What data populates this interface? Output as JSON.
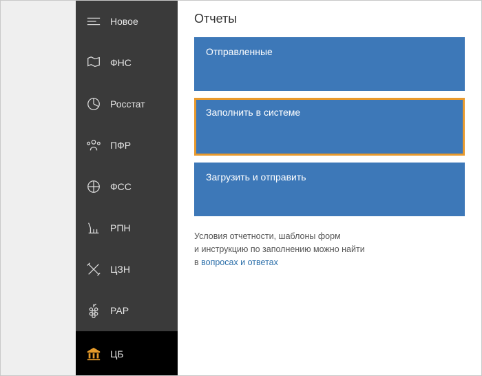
{
  "sidebar": {
    "items": [
      {
        "label": "Новое",
        "icon": "new-icon"
      },
      {
        "label": "ФНС",
        "icon": "flag-icon"
      },
      {
        "label": "Росстат",
        "icon": "piechart-icon"
      },
      {
        "label": "ПФР",
        "icon": "people-icon"
      },
      {
        "label": "ФСС",
        "icon": "shield-icon"
      },
      {
        "label": "РПН",
        "icon": "factory-icon"
      },
      {
        "label": "ЦЗН",
        "icon": "tools-icon"
      },
      {
        "label": "РАР",
        "icon": "grapes-icon"
      },
      {
        "label": "ЦБ",
        "icon": "bank-icon",
        "active": true
      }
    ]
  },
  "main": {
    "title": "Отчеты",
    "tiles": [
      {
        "label": "Отправленные"
      },
      {
        "label": "Заполнить в системе",
        "highlight": true
      },
      {
        "label": "Загрузить и отправить"
      }
    ],
    "hint_line1": "Условия отчетности, шаблоны форм",
    "hint_line2_a": "и инструкцию по заполнению можно найти",
    "hint_line3_prefix": "в ",
    "hint_link": "вопросах и ответах"
  }
}
